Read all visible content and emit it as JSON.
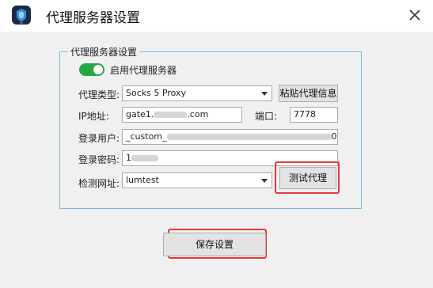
{
  "window": {
    "title": "代理服务器设置"
  },
  "group": {
    "legend": "代理服务器设置"
  },
  "toggle": {
    "label": "启用代理服务器",
    "enabled": true,
    "color": "#27a745"
  },
  "form": {
    "proxy_type_label": "代理类型:",
    "proxy_type_value": "Socks 5 Proxy",
    "paste_button": "粘贴代理信息",
    "ip_label": "IP地址:",
    "ip_value_prefix": "gate1.",
    "ip_value_suffix": ".com",
    "port_label": "端口:",
    "port_value": "7778",
    "user_label": "登录用户:",
    "user_value_prefix": "_custom_",
    "user_value_suffix": "0",
    "password_label": "登录密码:",
    "password_value_prefix": "1",
    "check_url_label": "检测网址:",
    "check_url_value": "lumtest",
    "test_button": "测试代理"
  },
  "save_button": "保存设置",
  "highlight_color": "#e53935"
}
